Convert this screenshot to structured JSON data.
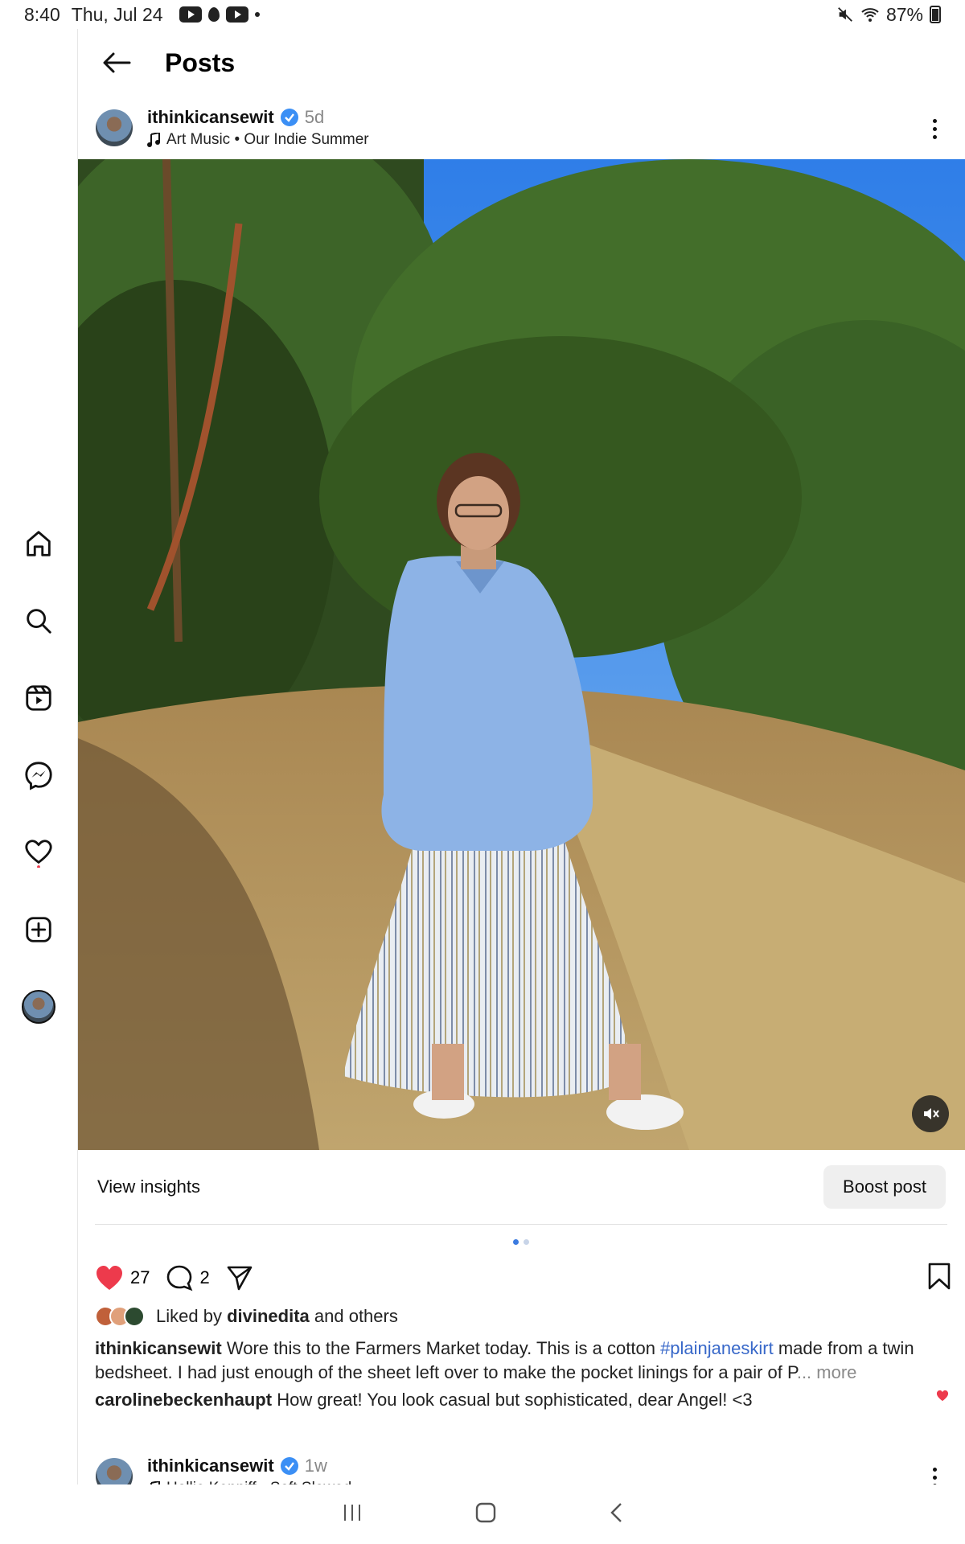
{
  "status_bar": {
    "time": "8:40",
    "date": "Thu, Jul 24",
    "battery": "87%"
  },
  "header": {
    "title": "Posts"
  },
  "left_nav": [
    {
      "name": "home-icon"
    },
    {
      "name": "search-icon"
    },
    {
      "name": "reels-icon"
    },
    {
      "name": "messenger-icon"
    },
    {
      "name": "heart-icon"
    },
    {
      "name": "create-icon"
    },
    {
      "name": "profile-avatar"
    }
  ],
  "post": {
    "username": "ithinkicansewit",
    "time": "5d",
    "music": "Art Music • Our Indie Summer",
    "insights_label": "View insights",
    "boost_label": "Boost post",
    "likes_count": "27",
    "comments_count": "2",
    "liked_by_prefix": "Liked by",
    "liked_by_user": "divinedita",
    "liked_by_suffix": "and others",
    "caption_user": "ithinkicansewit",
    "caption_text_1": "Wore this to the Farmers Market today. This is a cotton",
    "caption_hashtag": "#plainjaneskirt",
    "caption_text_2": "made from a twin bedsheet.  I had just enough of the sheet left over to make the pocket linings for a pair of P",
    "caption_more": "... more",
    "comment_user": "carolinebeckenhaupt",
    "comment_text": "How great!  You look casual but sophisticated, dear Angel! <3"
  },
  "next_post": {
    "username": "ithinkicansewit",
    "time": "1w",
    "music": "Hollie Kenniff • Soft Slowed"
  },
  "colors": {
    "accent": "#3b8ff5",
    "like": "#ed3a4c",
    "hashtag": "#3868c9"
  }
}
